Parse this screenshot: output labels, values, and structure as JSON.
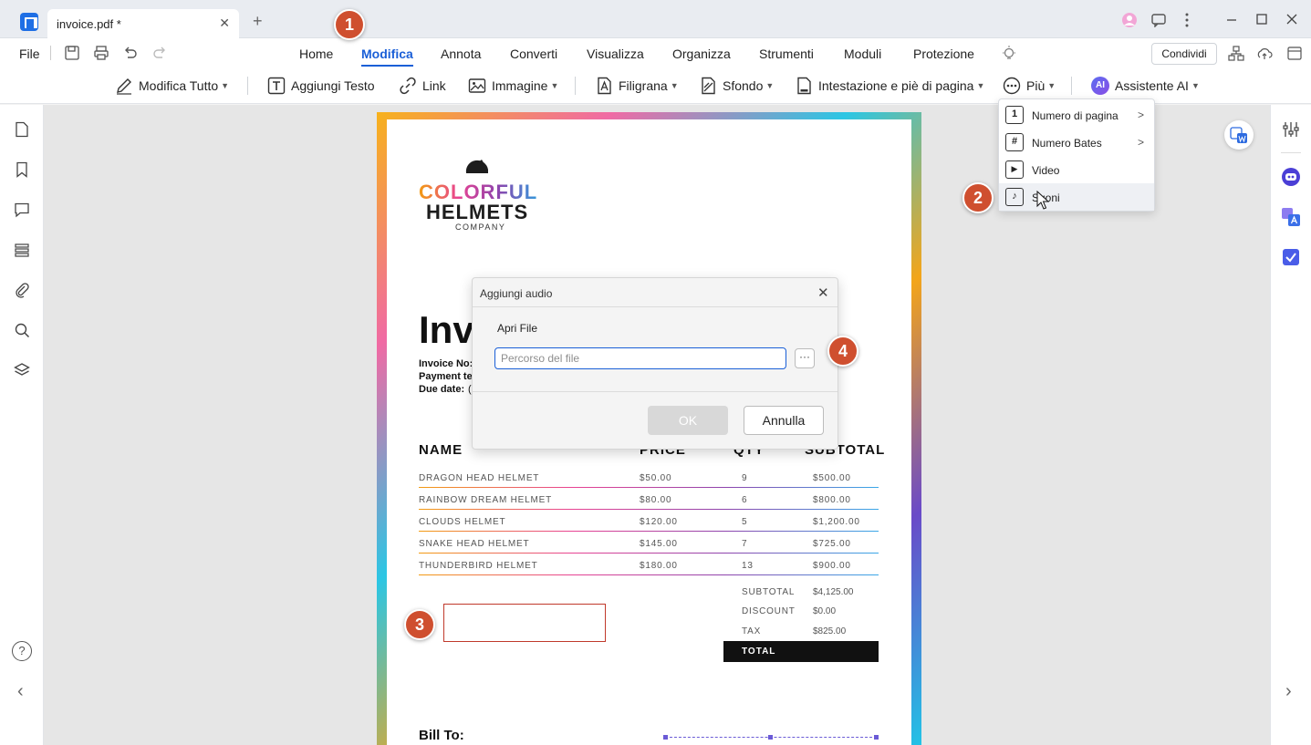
{
  "tab": {
    "title": "invoice.pdf *",
    "close": "✕",
    "new": "+"
  },
  "menu": {
    "file": "File",
    "share": "Condividi"
  },
  "nav_tabs": [
    "Home",
    "Modifica",
    "Annota",
    "Converti",
    "Visualizza",
    "Organizza",
    "Strumenti",
    "Moduli",
    "Protezione"
  ],
  "toolbar": {
    "edit_all": "Modifica Tutto",
    "add_text": "Aggiungi Testo",
    "link": "Link",
    "image": "Immagine",
    "watermark": "Filigrana",
    "background": "Sfondo",
    "header_footer": "Intestazione e piè di pagina",
    "more": "Più",
    "ai": "Assistente AI",
    "ai_badge": "AI"
  },
  "dropdown": {
    "items": [
      {
        "label": "Numero di pagina",
        "icon": "1",
        "has_submenu": true
      },
      {
        "label": "Numero Bates",
        "icon": "#",
        "has_submenu": true
      },
      {
        "label": "Video",
        "icon": "▶",
        "has_submenu": false
      },
      {
        "label": "Suoni",
        "icon": "♪",
        "has_submenu": false
      }
    ],
    "arrow": ">"
  },
  "document": {
    "company_line1": "COLORFUL",
    "company_line2": "HELMETS",
    "company_line3": "COMPANY",
    "title": "Inv",
    "invoice_no": "Invoice No:",
    "payment_terms": "Payment te",
    "due_date": "Due date:",
    "due_date_val": "(",
    "headers": {
      "name": "NAME",
      "price": "PRICE",
      "qty": "QTY",
      "subtotal": "SUBTOTAL"
    },
    "rows": [
      {
        "name": "DRAGON HEAD HELMET",
        "price": "$50.00",
        "qty": "9",
        "subtotal": "$500.00"
      },
      {
        "name": "RAINBOW DREAM HELMET",
        "price": "$80.00",
        "qty": "6",
        "subtotal": "$800.00"
      },
      {
        "name": "CLOUDS HELMET",
        "price": "$120.00",
        "qty": "5",
        "subtotal": "$1,200.00"
      },
      {
        "name": "SNAKE HEAD HELMET",
        "price": "$145.00",
        "qty": "7",
        "subtotal": "$725.00"
      },
      {
        "name": "THUNDERBIRD HELMET",
        "price": "$180.00",
        "qty": "13",
        "subtotal": "$900.00"
      }
    ],
    "totals": [
      {
        "label": "SUBTOTAL",
        "value": "$4,125.00"
      },
      {
        "label": "DISCOUNT",
        "value": "$0.00"
      },
      {
        "label": "TAX",
        "value": "$825.00"
      }
    ],
    "total_label": "TOTAL",
    "bill_to": "Bill To:"
  },
  "dialog": {
    "title": "Aggiungi audio",
    "open_file": "Apri File",
    "path_placeholder": "Percorso del file",
    "browse": "···",
    "ok": "OK",
    "cancel": "Annulla",
    "close": "✕"
  },
  "markers": [
    "1",
    "2",
    "3",
    "4"
  ],
  "rail": {
    "help": "?",
    "collapse_left": "‹",
    "expand_right": "›"
  }
}
